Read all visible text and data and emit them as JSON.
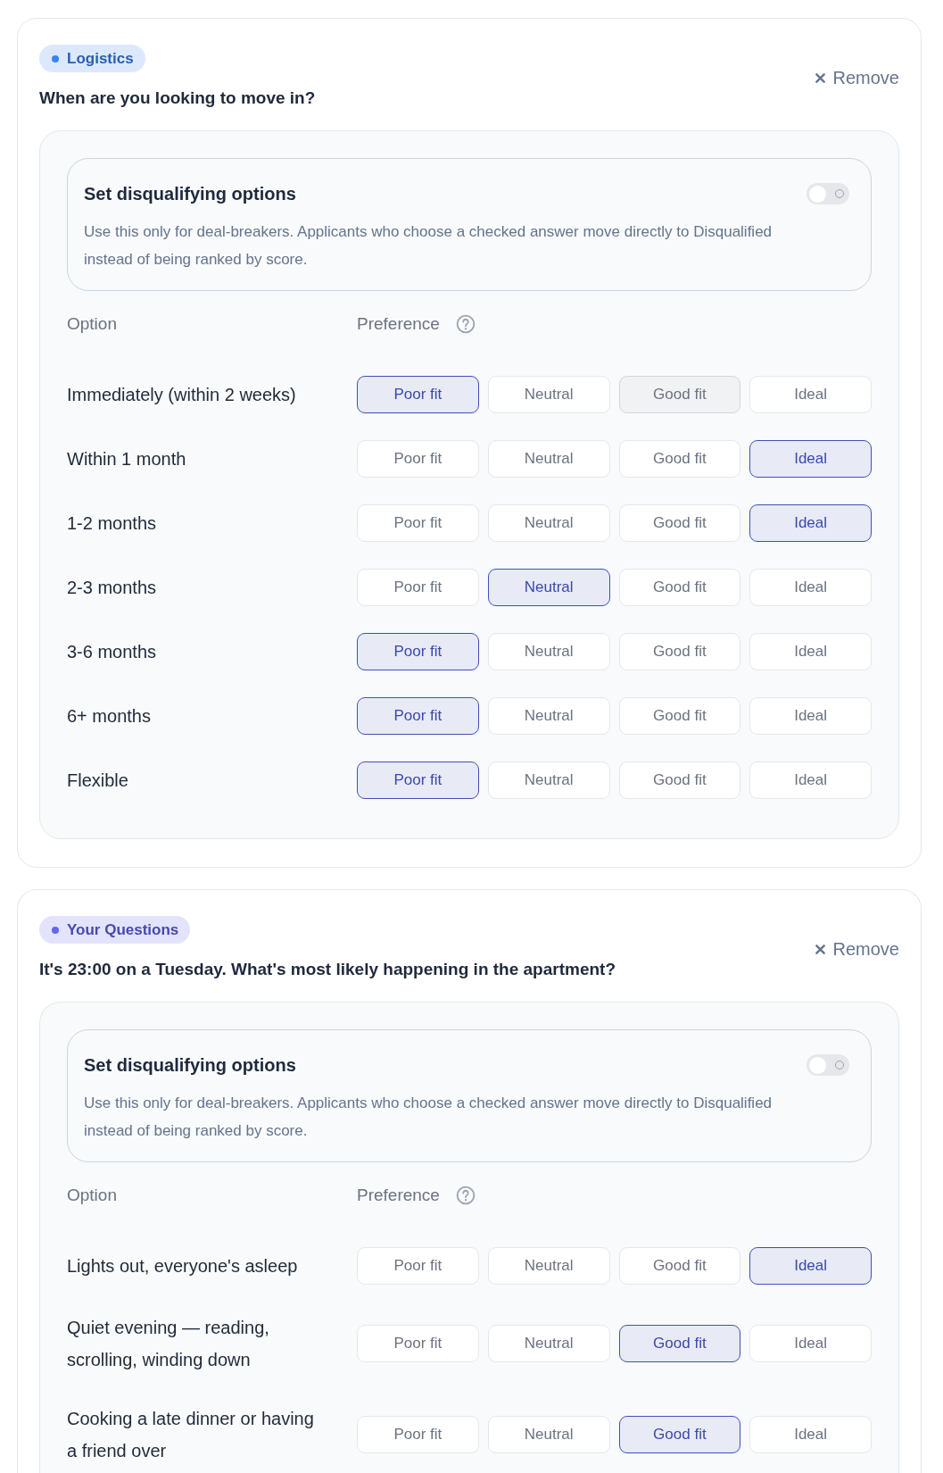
{
  "questions": [
    {
      "category": {
        "label": "Logistics",
        "color": "#3b82f6"
      },
      "title": "When are you looking to move in?",
      "remove": "Remove",
      "disqualify": {
        "title": "Set disqualifying options",
        "description": "Use this only for deal-breakers. Applicants who choose a checked answer move directly to Disqualified instead of being ranked by score.",
        "on": false
      },
      "columns": {
        "option": "Option",
        "preference": "Preference"
      },
      "options": [
        {
          "label": "Immediately (within 2 weeks)",
          "choices": [
            {
              "label": "Poor fit",
              "selected": true,
              "hovered": false
            },
            {
              "label": "Neutral",
              "selected": false,
              "hovered": false
            },
            {
              "label": "Good fit",
              "selected": false,
              "hovered": true
            },
            {
              "label": "Ideal",
              "selected": false,
              "hovered": false
            }
          ]
        },
        {
          "label": "Within 1 month",
          "choices": [
            {
              "label": "Poor fit",
              "selected": false,
              "hovered": false
            },
            {
              "label": "Neutral",
              "selected": false,
              "hovered": false
            },
            {
              "label": "Good fit",
              "selected": false,
              "hovered": false
            },
            {
              "label": "Ideal",
              "selected": true,
              "hovered": false
            }
          ]
        },
        {
          "label": "1-2 months",
          "choices": [
            {
              "label": "Poor fit",
              "selected": false,
              "hovered": false
            },
            {
              "label": "Neutral",
              "selected": false,
              "hovered": false
            },
            {
              "label": "Good fit",
              "selected": false,
              "hovered": false
            },
            {
              "label": "Ideal",
              "selected": true,
              "hovered": false
            }
          ]
        },
        {
          "label": "2-3 months",
          "choices": [
            {
              "label": "Poor fit",
              "selected": false,
              "hovered": false
            },
            {
              "label": "Neutral",
              "selected": true,
              "hovered": false
            },
            {
              "label": "Good fit",
              "selected": false,
              "hovered": false
            },
            {
              "label": "Ideal",
              "selected": false,
              "hovered": false
            }
          ]
        },
        {
          "label": "3-6 months",
          "choices": [
            {
              "label": "Poor fit",
              "selected": true,
              "hovered": false
            },
            {
              "label": "Neutral",
              "selected": false,
              "hovered": false
            },
            {
              "label": "Good fit",
              "selected": false,
              "hovered": false
            },
            {
              "label": "Ideal",
              "selected": false,
              "hovered": false
            }
          ]
        },
        {
          "label": "6+ months",
          "choices": [
            {
              "label": "Poor fit",
              "selected": true,
              "hovered": false
            },
            {
              "label": "Neutral",
              "selected": false,
              "hovered": false
            },
            {
              "label": "Good fit",
              "selected": false,
              "hovered": false
            },
            {
              "label": "Ideal",
              "selected": false,
              "hovered": false
            }
          ]
        },
        {
          "label": "Flexible",
          "choices": [
            {
              "label": "Poor fit",
              "selected": true,
              "hovered": false
            },
            {
              "label": "Neutral",
              "selected": false,
              "hovered": false
            },
            {
              "label": "Good fit",
              "selected": false,
              "hovered": false
            },
            {
              "label": "Ideal",
              "selected": false,
              "hovered": false
            }
          ]
        }
      ]
    },
    {
      "category": {
        "label": "Your Questions",
        "color": "#6366f1"
      },
      "title": "It's 23:00 on a Tuesday. What's most likely happening in the apartment?",
      "remove": "Remove",
      "disqualify": {
        "title": "Set disqualifying options",
        "description": "Use this only for deal-breakers. Applicants who choose a checked answer move directly to Disqualified instead of being ranked by score.",
        "on": false
      },
      "columns": {
        "option": "Option",
        "preference": "Preference"
      },
      "options": [
        {
          "label": "Lights out, everyone's asleep",
          "choices": [
            {
              "label": "Poor fit",
              "selected": false,
              "hovered": false
            },
            {
              "label": "Neutral",
              "selected": false,
              "hovered": false
            },
            {
              "label": "Good fit",
              "selected": false,
              "hovered": false
            },
            {
              "label": "Ideal",
              "selected": true,
              "hovered": false
            }
          ]
        },
        {
          "label": "Quiet evening — reading, scrolling, winding down",
          "choices": [
            {
              "label": "Poor fit",
              "selected": false,
              "hovered": false
            },
            {
              "label": "Neutral",
              "selected": false,
              "hovered": false
            },
            {
              "label": "Good fit",
              "selected": true,
              "hovered": false
            },
            {
              "label": "Ideal",
              "selected": false,
              "hovered": false
            }
          ]
        },
        {
          "label": "Cooking a late dinner or having a friend over",
          "choices": [
            {
              "label": "Poor fit",
              "selected": false,
              "hovered": false
            },
            {
              "label": "Neutral",
              "selected": false,
              "hovered": false
            },
            {
              "label": "Good fit",
              "selected": true,
              "hovered": false
            },
            {
              "label": "Ideal",
              "selected": false,
              "hovered": false
            }
          ]
        }
      ]
    }
  ]
}
